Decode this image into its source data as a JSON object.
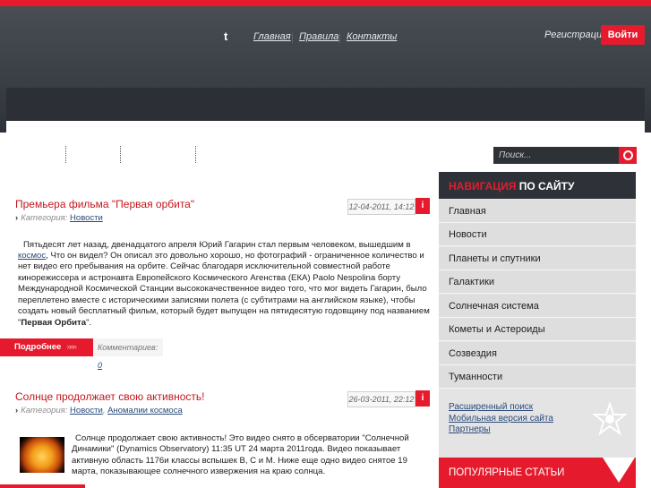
{
  "header": {
    "nav": [
      "Главная",
      "Правила",
      "Контакты"
    ],
    "twitter_icon": "t",
    "register": "Регистрация",
    "login": "Войти"
  },
  "search": {
    "placeholder": "Поиск..."
  },
  "articles": [
    {
      "title": "Премьера фильма \"Первая орбита\"",
      "date": "12-04-2011, 14:12",
      "category_label": "Категория:",
      "categories": [
        "Новости"
      ],
      "body_lines": [
        "Пятьдесят лет назад, двенадцатого апреля Юрий Гагарин стал первым человеком, вышедшим в",
        ", Что он видел? Он описал это довольно хорошо, но фотографий - ограниченное количество и",
        "нет видео его пребывания на орбите. Сейчас благодаря исключительной совместной работе",
        "кинорежиссера и астронавта Европейского Космического Агенства (ЕКА) Paolo Nespolina борту",
        "Международной Космической Станции высококачественное видео того, что мог видеть Гагарин, было",
        "переплетено вместе с историческими записями полета (с субтитрами на английском языке), чтобы",
        "создать новый бесплатный фильм, который будет выпущен на пятидесятую годовщину под названием"
      ],
      "body_link": "космос",
      "body_end_bold": "Первая Орбита",
      "more": "Подробнее",
      "comments_label": "Комментариев:",
      "comments_count": "0"
    },
    {
      "title": "Солнце продолжает свою активность!",
      "date": "26-03-2011, 22:12",
      "category_label": "Категория:",
      "categories": [
        "Новости",
        "Аномалии космоса"
      ],
      "body_lines": [
        "Солнце продолжает свою активность! Это видео снято в обсерватории \"Солнечной",
        "Динамики\" (Dynamics Observatory) 11:35 UT 24 марта 2011года. Видео показывает",
        "активную область 1176и классы вспышек B, C и M. Ниже еще одно видео снятое 19",
        "марта, показывающее солнечного извержения на краю солнца."
      ]
    }
  ],
  "sidebar": {
    "heading_accent": "НАВИГАЦИЯ",
    "heading_rest": "ПО САЙТУ",
    "items": [
      "Главная",
      "Новости",
      "Планеты и спутники",
      "Галактики",
      "Солнечная система",
      "Кометы и Астероиды",
      "Созвездия",
      "Туманности"
    ],
    "links": [
      "Расширенный поиск",
      "Мобильная версия сайта",
      "Партнеры"
    ],
    "popular": "ПОПУЛЯРНЫЕ СТАТЬИ"
  },
  "colors": {
    "accent": "#e51b2d",
    "dark": "#2e3238",
    "link": "#2a4a7a"
  }
}
